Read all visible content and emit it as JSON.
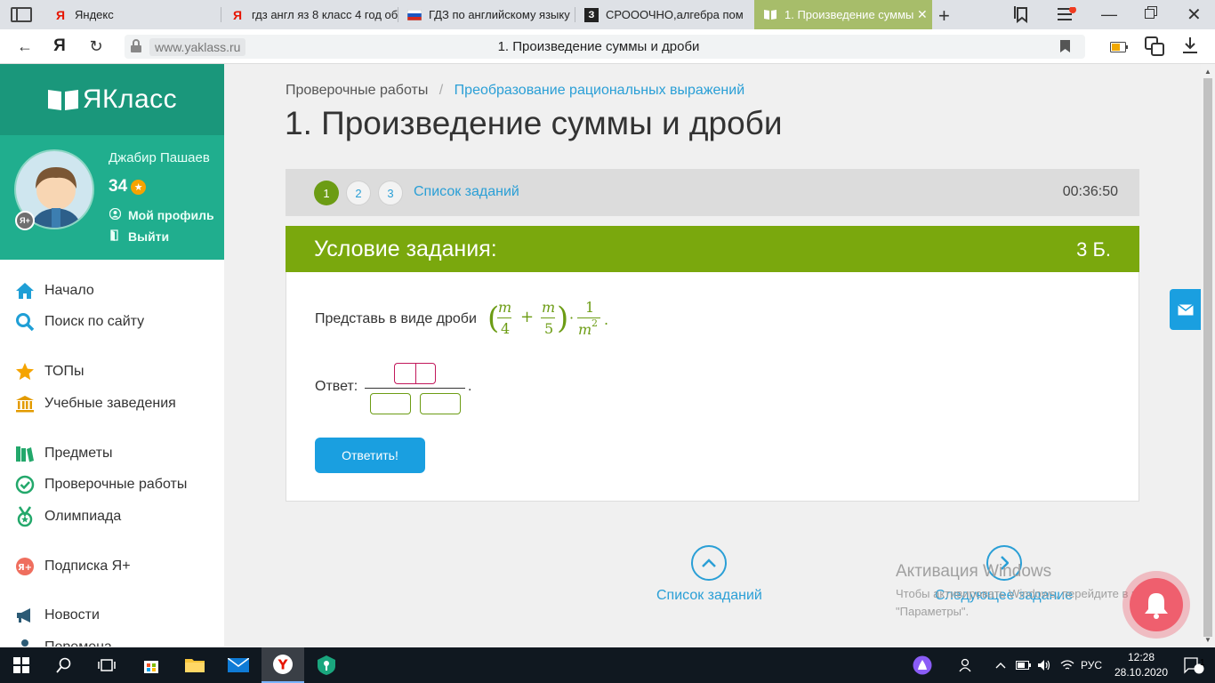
{
  "browser": {
    "tabs": [
      {
        "label": "Яндекс",
        "icon": "yandex-icon",
        "active": false
      },
      {
        "label": "гдз англ яз 8 класс 4 год об",
        "icon": "yandex-icon",
        "active": false
      },
      {
        "label": "ГДЗ по английскому языку",
        "icon": "flag-ru-icon",
        "active": false
      },
      {
        "label": "СРОООЧНО,алгебра пом",
        "icon": "znanija-icon",
        "active": false
      },
      {
        "label": "1. Произведение суммы",
        "icon": "book-icon",
        "active": true
      }
    ],
    "address": {
      "domain": "www.yaklass.ru",
      "title": "1. Произведение суммы и дроби"
    }
  },
  "sidebar": {
    "logo": "ЯКласс",
    "user": {
      "name": "Джабир Пашаев",
      "points": "34",
      "badge": "Я+",
      "profile_link": "Мой профиль",
      "logout_link": "Выйти"
    },
    "menu": [
      {
        "label": "Начало",
        "icon": "home-icon"
      },
      {
        "label": "Поиск по сайту",
        "icon": "search-icon"
      },
      {
        "label": "ТОПы",
        "icon": "star-icon"
      },
      {
        "label": "Учебные заведения",
        "icon": "building-icon"
      },
      {
        "label": "Предметы",
        "icon": "books-icon"
      },
      {
        "label": "Проверочные работы",
        "icon": "check-circle-icon"
      },
      {
        "label": "Олимпиада",
        "icon": "medal-icon"
      },
      {
        "label": "Подписка Я+",
        "icon": "yplus-icon"
      },
      {
        "label": "Новости",
        "icon": "megaphone-icon"
      },
      {
        "label": "Перемена",
        "icon": "person-icon"
      }
    ]
  },
  "main": {
    "breadcrumb": {
      "root": "Проверочные работы",
      "current": "Преобразование рациональных выражений"
    },
    "title": "1. Произведение суммы и дроби",
    "steps": [
      "1",
      "2",
      "3"
    ],
    "current_step": "1",
    "task_list_link": "Список заданий",
    "timer": "00:36:50",
    "condition_title": "Условие задания:",
    "condition_points": "3 Б.",
    "prompt": "Представь в виде дроби",
    "math": {
      "m": "m",
      "four": "4",
      "plus": "+",
      "five": "5",
      "dot": "·",
      "one": "1",
      "sq": "2",
      "period": "."
    },
    "answer_label": "Ответ:",
    "answer_period": ".",
    "submit_button": "Ответить!",
    "bottom_nav": {
      "list": "Список заданий",
      "next": "Следующее задание"
    }
  },
  "watermark": {
    "title": "Активация Windows",
    "line": "Чтобы активировать Windows, перейдите в раздел \"Параметры\"."
  },
  "taskbar": {
    "lang": "РУС",
    "time": "12:28",
    "date": "28.10.2020",
    "notifications": "1"
  },
  "colors": {
    "brand_dark": "#1a977b",
    "brand": "#20ae8e",
    "accent_green": "#7aa80d",
    "link_blue": "#2a9fd6",
    "button_blue": "#1a9fe0"
  }
}
